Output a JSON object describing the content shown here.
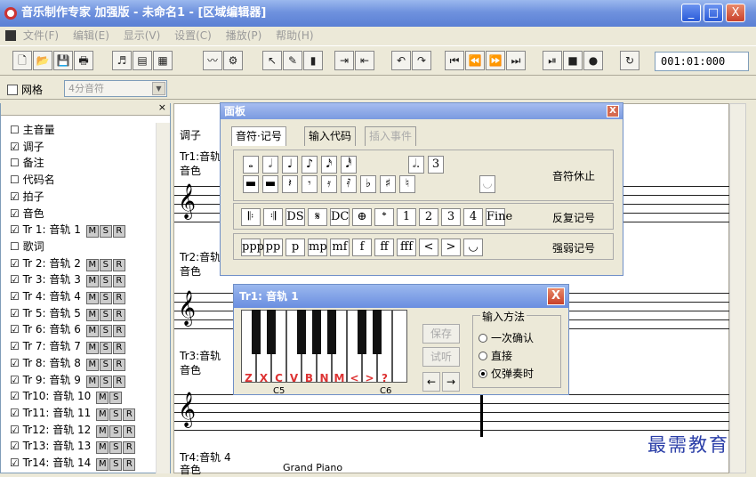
{
  "window": {
    "title": "音乐制作专家 加强版 - 未命名1 - [区域编辑器]",
    "min": "_",
    "max": "□",
    "close": "X"
  },
  "menu": [
    "文件(F)",
    "编辑(E)",
    "显示(V)",
    "设置(C)",
    "播放(P)",
    "帮助(H)"
  ],
  "toolbar": {
    "time": "001:01:000"
  },
  "bar2": {
    "grid_label": "网格",
    "grid_value": "4分音符"
  },
  "left_items": [
    {
      "check": "☐",
      "label": "主音量"
    },
    {
      "check": "☑",
      "label": "调子"
    },
    {
      "check": "☐",
      "label": "备注"
    },
    {
      "check": "☐",
      "label": "代码名"
    },
    {
      "check": "☑",
      "label": "拍子"
    },
    {
      "check": "☑",
      "label": "音色"
    },
    {
      "check": "☑",
      "label": "Tr 1: 音轨 1"
    },
    {
      "check": "☐",
      "label": "歌词"
    },
    {
      "check": "☑",
      "label": "Tr 2: 音轨 2"
    },
    {
      "check": "☑",
      "label": "Tr 3: 音轨 3"
    },
    {
      "check": "☑",
      "label": "Tr 4: 音轨 4"
    },
    {
      "check": "☑",
      "label": "Tr 5: 音轨 5"
    },
    {
      "check": "☑",
      "label": "Tr 6: 音轨 6"
    },
    {
      "check": "☑",
      "label": "Tr 7: 音轨 7"
    },
    {
      "check": "☑",
      "label": "Tr 8: 音轨 8"
    },
    {
      "check": "☑",
      "label": "Tr 9: 音轨 9"
    },
    {
      "check": "☑",
      "label": "Tr10: 音轨 10"
    },
    {
      "check": "☑",
      "label": "Tr11: 音轨 11"
    },
    {
      "check": "☑",
      "label": "Tr12: 音轨 12"
    },
    {
      "check": "☑",
      "label": "Tr13: 音轨 13"
    },
    {
      "check": "☑",
      "label": "Tr14: 音轨 14"
    }
  ],
  "msr": [
    "M",
    "S",
    "R"
  ],
  "score": {
    "keysig": "调子",
    "tr1": "Tr1:音轨",
    "tr2": "Tr2:音轨",
    "tr3": "Tr3:音轨",
    "tr4": "Tr4:音轨 4",
    "timbre": "音色",
    "instrument": "Grand Piano"
  },
  "panel": {
    "title": "面板",
    "close": "X",
    "tabs": [
      "音符·记号",
      "输入代码",
      "插入事件"
    ],
    "notes_label": "音符休止",
    "repeat_label": "反复记号",
    "dyn_label": "强弱记号",
    "notes_row1": [
      "𝅝",
      "𝅗𝅥",
      "♩",
      "♪",
      "𝅘𝅥𝅯",
      "𝅘𝅥𝅰",
      "𝅗𝅥.",
      "3"
    ],
    "notes_row2": [
      "▬",
      "▬",
      "𝄽",
      "𝄾",
      "𝄿",
      "𝅀",
      "♭",
      "♯",
      "♮"
    ],
    "repeat": [
      "𝄆",
      "𝄇",
      "DS",
      "𝄋",
      "DC",
      "⊕",
      "𝄌",
      "1",
      "2",
      "3",
      "4",
      "Fine"
    ],
    "dynamics": [
      "ppp",
      "pp",
      "p",
      "mp",
      "mf",
      "f",
      "ff",
      "fff",
      "<",
      ">",
      "◡"
    ]
  },
  "piano": {
    "title": "Tr1: 音轨 1",
    "close": "X",
    "keys": [
      "Z",
      "X",
      "C",
      "V",
      "B",
      "N",
      "M",
      "<",
      ">",
      "?"
    ],
    "c5": "C5",
    "c6": "C6",
    "save": "保存",
    "listen": "试听",
    "left": "←",
    "right": "→",
    "method_title": "输入方法",
    "methods": [
      "一次确认",
      "直接",
      "仅弹奏时"
    ]
  },
  "watermark": "最需教育"
}
